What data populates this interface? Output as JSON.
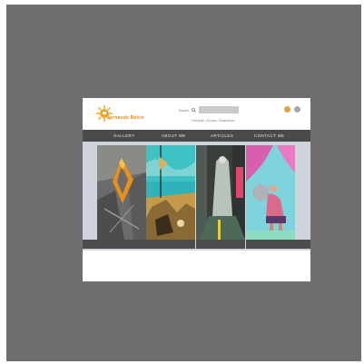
{
  "logo": {
    "text": "Fernanda Beiris"
  },
  "header": {
    "search_label": "Search",
    "search_value": "",
    "tagline": "Paintings • Murals • Illustrations"
  },
  "nav": {
    "items": [
      {
        "label": "GALLERY"
      },
      {
        "label": "ABOUT ME"
      },
      {
        "label": "ARTICLES"
      },
      {
        "label": "CONTACT ME"
      }
    ]
  },
  "gallery": {
    "paintings": [
      {
        "icon": "abstract-painting"
      },
      {
        "icon": "surreal-landscape-painting"
      },
      {
        "icon": "figure-window-painting"
      },
      {
        "icon": "seated-figure-painting"
      }
    ]
  },
  "colors": {
    "frame": "#6f6f6f",
    "nav_bg": "#4a4a4a",
    "accent": "#e88a14",
    "gallery_bg": "#cfd3db"
  }
}
